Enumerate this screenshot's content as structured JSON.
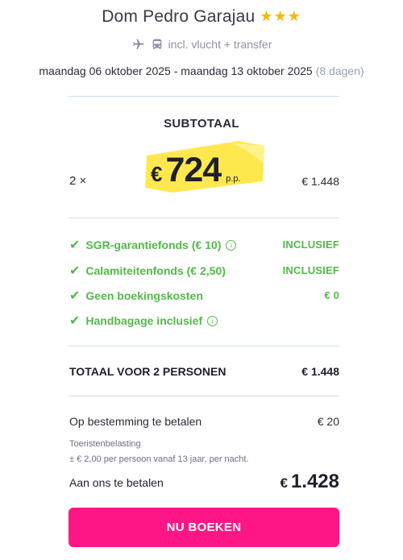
{
  "hotel": {
    "name": "Dom Pedro Garajau",
    "stars": "★★★"
  },
  "includes": {
    "text": "incl. vlucht + transfer",
    "icons": [
      "plane-icon",
      "bus-icon"
    ]
  },
  "trip": {
    "dates": "maandag 06 oktober 2025 - maandag 13 oktober 2025",
    "duration": "(8 dagen)"
  },
  "subtotal": {
    "label": "SUBTOTAAL",
    "quantity": "2 ×",
    "currency": "€",
    "price": "724",
    "per_person": "p.p.",
    "line_total": "€ 1.448"
  },
  "features": [
    {
      "label": "SGR-garantiefonds (€ 10)",
      "value": "INCLUSIEF",
      "info": true
    },
    {
      "label": "Calamiteitenfonds (€ 2,50)",
      "value": "INCLUSIEF",
      "info": false
    },
    {
      "label": "Geen boekingskosten",
      "value": "€ 0",
      "info": false
    },
    {
      "label": "Handbagage inclusief",
      "value": "",
      "info": true
    }
  ],
  "total": {
    "label": "TOTAAL VOOR 2 PERSONEN",
    "value": "€ 1.448"
  },
  "destination": {
    "label": "Op bestemming te betalen",
    "value": "€ 20",
    "tax_label": "Toeristenbelasting",
    "tax_note": "± € 2,00 per persoon vanaf 13 jaar, per nacht."
  },
  "payment": {
    "label": "Aan ons te betalen",
    "currency": "€",
    "amount": "1.428"
  },
  "cta": {
    "label": "NU BOEKEN"
  },
  "colors": {
    "accent": "#ff1686",
    "success": "#53b948",
    "highlight": "#ffe84d",
    "stars": "#f5b800"
  }
}
